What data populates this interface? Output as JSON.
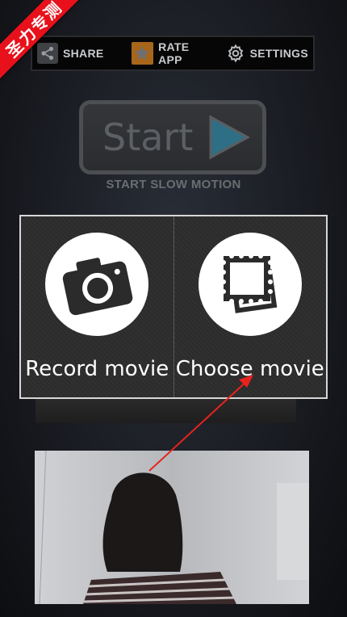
{
  "watermark": "圣力专测",
  "toolbar": {
    "share_label": "SHARE",
    "share_icon": "share-icon",
    "rate_label": "RATE APP",
    "rate_icon": "star-icon",
    "settings_label": "SETTINGS",
    "settings_icon": "gear-icon"
  },
  "start": {
    "button_text": "Start",
    "play_icon": "play-icon",
    "subtitle": "START SLOW MOTION"
  },
  "choices": [
    {
      "label": "Record movie",
      "icon": "camera-icon"
    },
    {
      "label": "Choose movie",
      "icon": "gallery-stamps-icon"
    }
  ],
  "preview": {
    "description_icon": "video-preview"
  },
  "colors": {
    "ribbon": "#e8101a",
    "play_accent": "#2e6f86",
    "rate_accent": "#a8661b",
    "arrow": "#e8231e"
  }
}
